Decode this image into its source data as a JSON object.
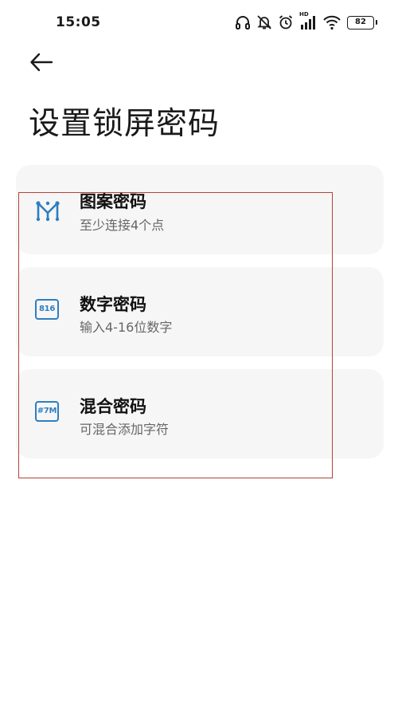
{
  "status_bar": {
    "time": "15:05",
    "hd_label": "HD",
    "battery": "82",
    "icons": [
      "headphones-icon",
      "bell-off-icon",
      "alarm-icon",
      "signal-icon",
      "wifi-icon",
      "battery-icon"
    ]
  },
  "header": {
    "back_icon": "arrow-left-icon",
    "title": "设置锁屏密码"
  },
  "options": [
    {
      "icon": "pattern-icon",
      "title": "图案密码",
      "description": "至少连接4个点"
    },
    {
      "icon": "numeric-code-icon",
      "icon_text": "816",
      "title": "数字密码",
      "description": "输入4-16位数字"
    },
    {
      "icon": "mixed-code-icon",
      "icon_text": "#7M",
      "title": "混合密码",
      "description": "可混合添加字符"
    }
  ],
  "colors": {
    "accent": "#2f7ec0",
    "card_bg": "#f6f6f6",
    "highlight_border": "#b0443a"
  }
}
